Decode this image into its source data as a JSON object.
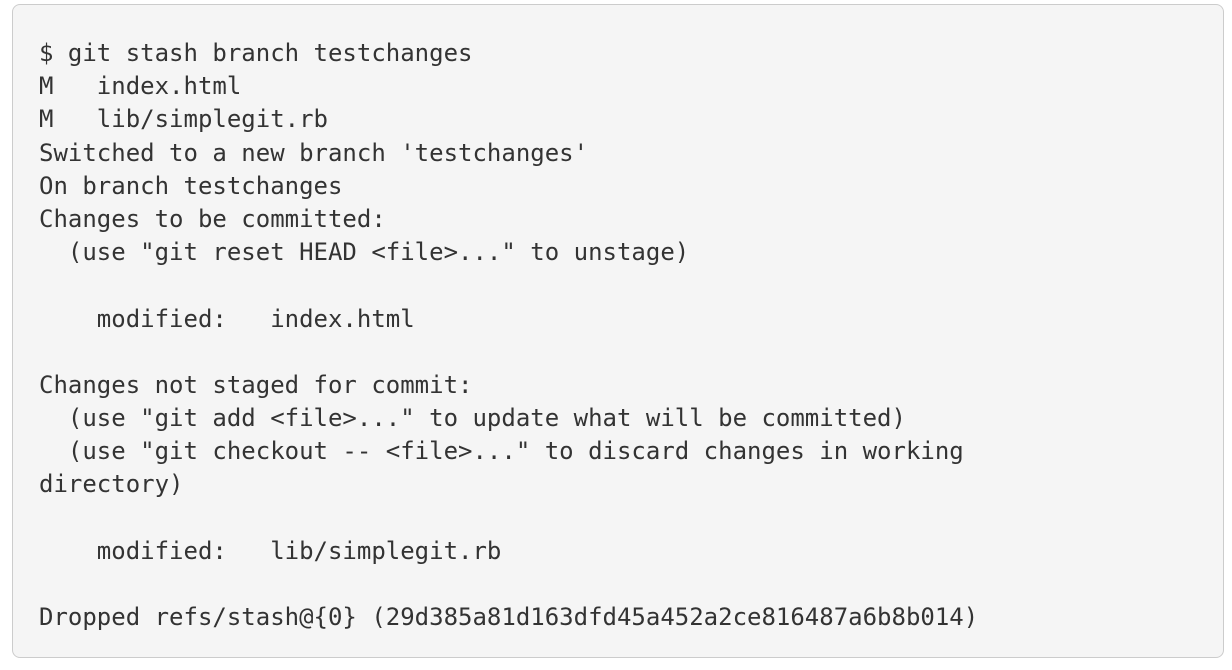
{
  "terminal": {
    "lines": [
      "$ git stash branch testchanges",
      "M   index.html",
      "M   lib/simplegit.rb",
      "Switched to a new branch 'testchanges'",
      "On branch testchanges",
      "Changes to be committed:",
      "  (use \"git reset HEAD <file>...\" to unstage)",
      "",
      "    modified:   index.html",
      "",
      "Changes not staged for commit:",
      "  (use \"git add <file>...\" to update what will be committed)",
      "  (use \"git checkout -- <file>...\" to discard changes in working",
      "directory)",
      "",
      "    modified:   lib/simplegit.rb",
      "",
      "Dropped refs/stash@{0} (29d385a81d163dfd45a452a2ce816487a6b8b014)"
    ]
  }
}
